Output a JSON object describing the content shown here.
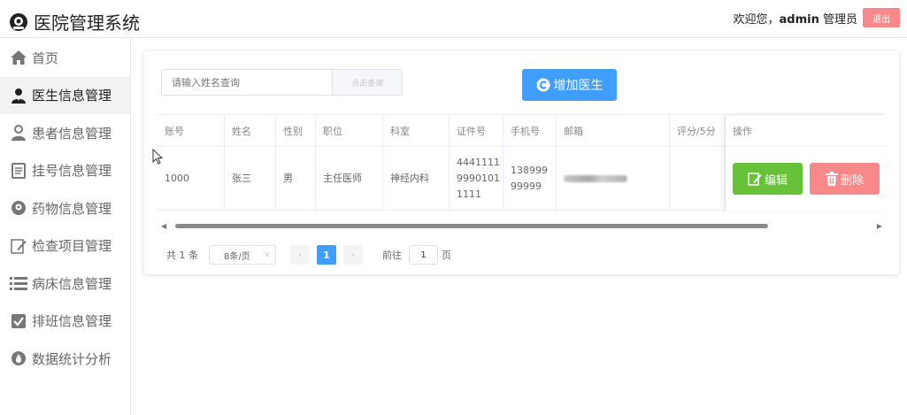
{
  "app": {
    "title": "医院管理系统"
  },
  "header": {
    "welcome_prefix": "欢迎您，",
    "username": "admin",
    "role": "管理员",
    "logout_label": "退出"
  },
  "sidebar": {
    "items": [
      {
        "label": "首页",
        "icon": "home-icon"
      },
      {
        "label": "医生信息管理",
        "icon": "doctor-icon",
        "active": true
      },
      {
        "label": "患者信息管理",
        "icon": "user-icon"
      },
      {
        "label": "挂号信息管理",
        "icon": "document-icon"
      },
      {
        "label": "药物信息管理",
        "icon": "medicine-icon"
      },
      {
        "label": "检查项目管理",
        "icon": "edit-icon"
      },
      {
        "label": "病床信息管理",
        "icon": "list-icon"
      },
      {
        "label": "排班信息管理",
        "icon": "checkbox-icon"
      },
      {
        "label": "数据统计分析",
        "icon": "drop-icon"
      }
    ]
  },
  "search": {
    "placeholder": "请输入姓名查询",
    "button_label": "点击查询"
  },
  "add_button_label": "增加医生",
  "table": {
    "columns": [
      "账号",
      "姓名",
      "性别",
      "职位",
      "科室",
      "证件号",
      "手机号",
      "邮箱",
      "评分/5分",
      "操作"
    ],
    "rows": [
      {
        "account": "1000",
        "name": "张三",
        "gender": "男",
        "position": "主任医师",
        "department": "神经内科",
        "id_number": "444111199901011111",
        "phone": "13899999999",
        "email": "",
        "rating": ""
      }
    ]
  },
  "actions": {
    "edit_label": "编辑",
    "delete_label": "删除"
  },
  "pagination": {
    "total_label": "共 1 条",
    "page_size_label": "8条/页",
    "current_page": "1",
    "prev": "‹",
    "next": "›",
    "goto_label": "前往",
    "goto_value": "1",
    "goto_suffix": "页"
  },
  "colors": {
    "primary": "#409eff",
    "success": "#67c23a",
    "danger": "#f78989"
  }
}
